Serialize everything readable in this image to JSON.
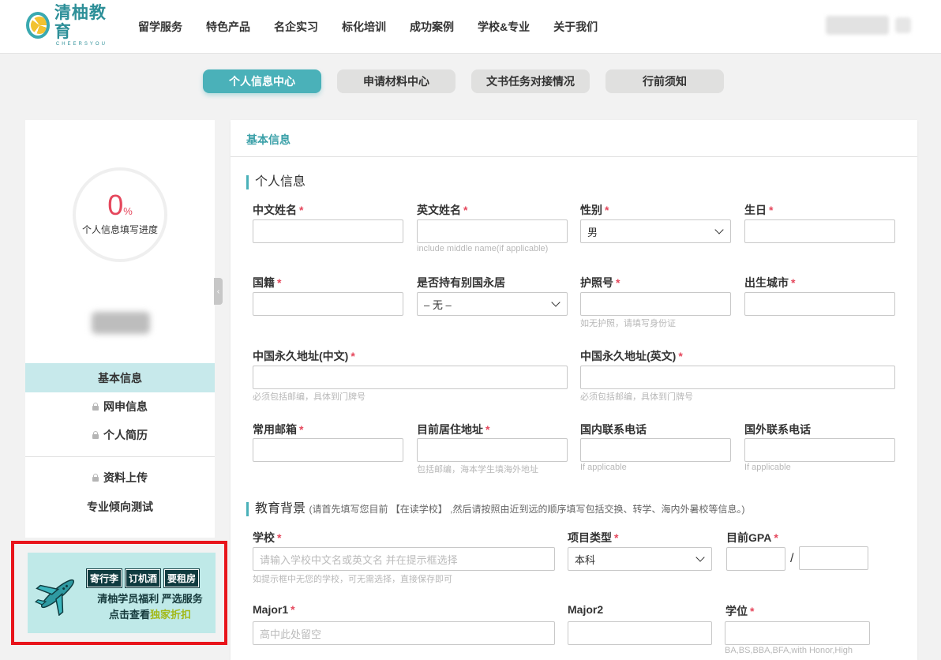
{
  "nav": {
    "logo_cn": "清柚教育",
    "logo_en": "CHEERSYOU",
    "links": [
      "留学服务",
      "特色产品",
      "名企实习",
      "标化培训",
      "成功案例",
      "学校&专业",
      "关于我们"
    ]
  },
  "tabs": [
    "个人信息中心",
    "申请材料中心",
    "文书任务对接情况",
    "行前须知"
  ],
  "sidebar": {
    "progress_value": "0",
    "progress_unit": "%",
    "progress_label": "个人信息填写进度",
    "items": [
      "基本信息",
      "网申信息",
      "个人简历",
      "资料上传",
      "专业倾向测试"
    ]
  },
  "promo": {
    "tags": [
      "寄行李",
      "订机酒",
      "要租房"
    ],
    "line1": "清柚学员福利 严选服务",
    "line2_prefix": "点击查看",
    "line2_highlight": "独家折扣"
  },
  "panel": {
    "title": "基本信息",
    "section_personal": "个人信息",
    "section_education": "教育背景",
    "section_education_note": "(请首先填写您目前 【在读学校】 ,然后请按照由近到远的顺序填写包括交换、转学、海内外暑校等信息。)",
    "fields": {
      "cn_name": "中文姓名",
      "en_name": "英文姓名",
      "en_name_hint": "include middle name(if applicable)",
      "gender": "性别",
      "gender_value": "男",
      "birthday": "生日",
      "nationality": "国籍",
      "other_pr": "是否持有别国永居",
      "other_pr_value": "– 无 –",
      "passport": "护照号",
      "passport_hint": "如无护照，请填写身份证",
      "birth_city": "出生城市",
      "cn_address_cn": "中国永久地址(中文)",
      "cn_address_cn_hint": "必须包括邮编，具体到门牌号",
      "cn_address_en": "中国永久地址(英文)",
      "cn_address_en_hint": "必须包括邮编，具体到门牌号",
      "email": "常用邮箱",
      "current_address": "目前居住地址",
      "current_address_hint": "包括邮编，海本学生填海外地址",
      "domestic_phone": "国内联系电话",
      "domestic_phone_hint": "If applicable",
      "foreign_phone": "国外联系电话",
      "foreign_phone_hint": "If applicable",
      "school": "学校",
      "school_placeholder": "请输入学校中文名或英文名 并在提示框选择",
      "school_hint": "如提示框中无您的学校，可无需选择，直接保存即可",
      "program_type": "项目类型",
      "program_type_value": "本科",
      "gpa": "目前GPA",
      "gpa_sep": "/",
      "major1": "Major1",
      "major1_placeholder": "高中此处留空",
      "major2": "Major2",
      "degree": "学位",
      "degree_hint": "BA,BS,BBA,BFA,with Honor,High"
    },
    "required_mark": "*"
  }
}
